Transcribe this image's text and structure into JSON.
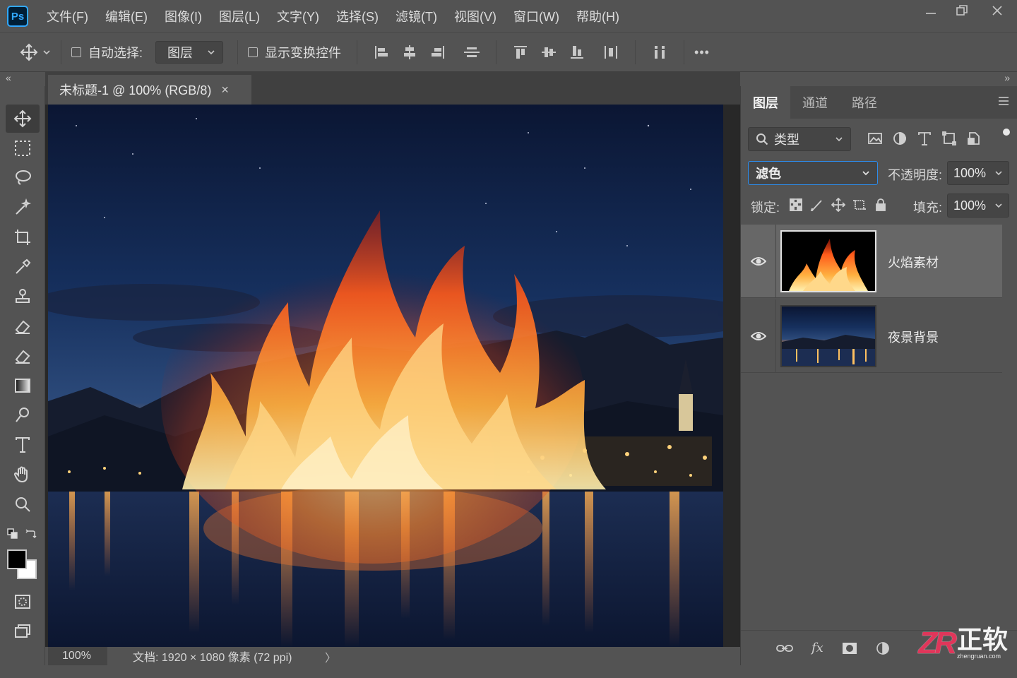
{
  "app": {
    "logo_text": "Ps"
  },
  "menu": [
    "文件(F)",
    "编辑(E)",
    "图像(I)",
    "图层(L)",
    "文字(Y)",
    "选择(S)",
    "滤镜(T)",
    "视图(V)",
    "窗口(W)",
    "帮助(H)"
  ],
  "options_bar": {
    "auto_select_label": "自动选择:",
    "auto_select_target": "图层",
    "show_transform_label": "显示变换控件",
    "more_label": "•••"
  },
  "document": {
    "tab_title": "未标题-1 @ 100% (RGB/8)",
    "tab_close": "×",
    "zoom": "100%",
    "info": "文档: 1920 × 1080 像素 (72 ppi)",
    "info_arrow": "〉"
  },
  "layers_panel": {
    "tabs": [
      "图层",
      "通道",
      "路径"
    ],
    "filter_type": "类型",
    "blend_mode": "滤色",
    "opacity_label": "不透明度:",
    "opacity_value": "100%",
    "lock_label": "锁定:",
    "fill_label": "填充:",
    "fill_value": "100%",
    "layers": [
      {
        "name": "火焰素材",
        "selected": true,
        "visible": true
      },
      {
        "name": "夜景背景",
        "selected": false,
        "visible": true
      }
    ],
    "footer_fx": "fx"
  },
  "watermark": {
    "logo": "ZR",
    "name": "正软",
    "url": "zhengruan.com"
  },
  "colors": {
    "accent": "#2d8ceb",
    "ps_blue": "#31a8ff",
    "foreground": "#000000",
    "background": "#ffffff"
  }
}
